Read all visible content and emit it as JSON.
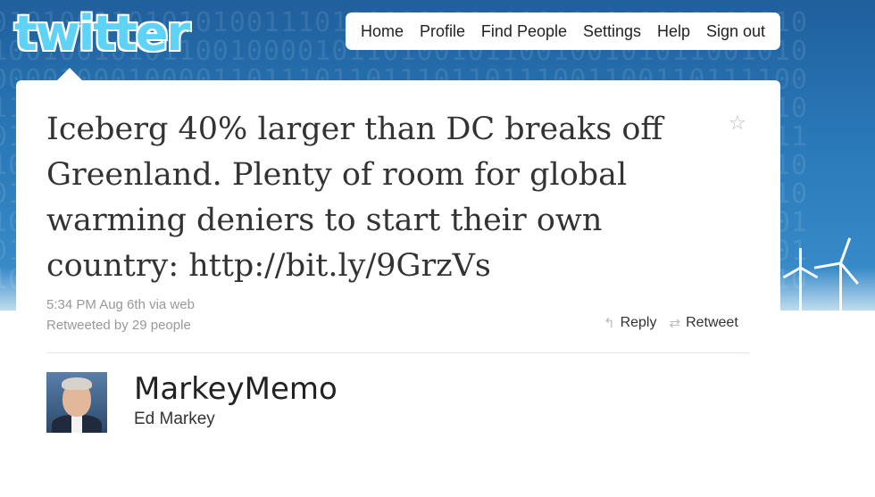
{
  "logo": {
    "text": "twitter"
  },
  "nav": {
    "items": [
      "Home",
      "Profile",
      "Find People",
      "Settings",
      "Help",
      "Sign out"
    ]
  },
  "tweet": {
    "text": "Iceberg 40% larger than DC breaks off Greenland. Plenty of room for global warming deniers to start their own country: http://bit.ly/9GrzVs",
    "timestamp": "5:34 PM Aug 6th via web",
    "retweeted": "Retweeted by 29 people",
    "reply_label": "Reply",
    "retweet_label": "Retweet",
    "star_icon": "star-icon",
    "reply_icon": "reply-icon",
    "retweet_icon": "retweet-icon"
  },
  "author": {
    "username": "MarkeyMemo",
    "name": "Ed Markey"
  },
  "colors": {
    "background_blue": "#2a78b8",
    "logo_cyan": "#5fd3f5",
    "text_dark": "#333333",
    "meta_gray": "#999999"
  }
}
